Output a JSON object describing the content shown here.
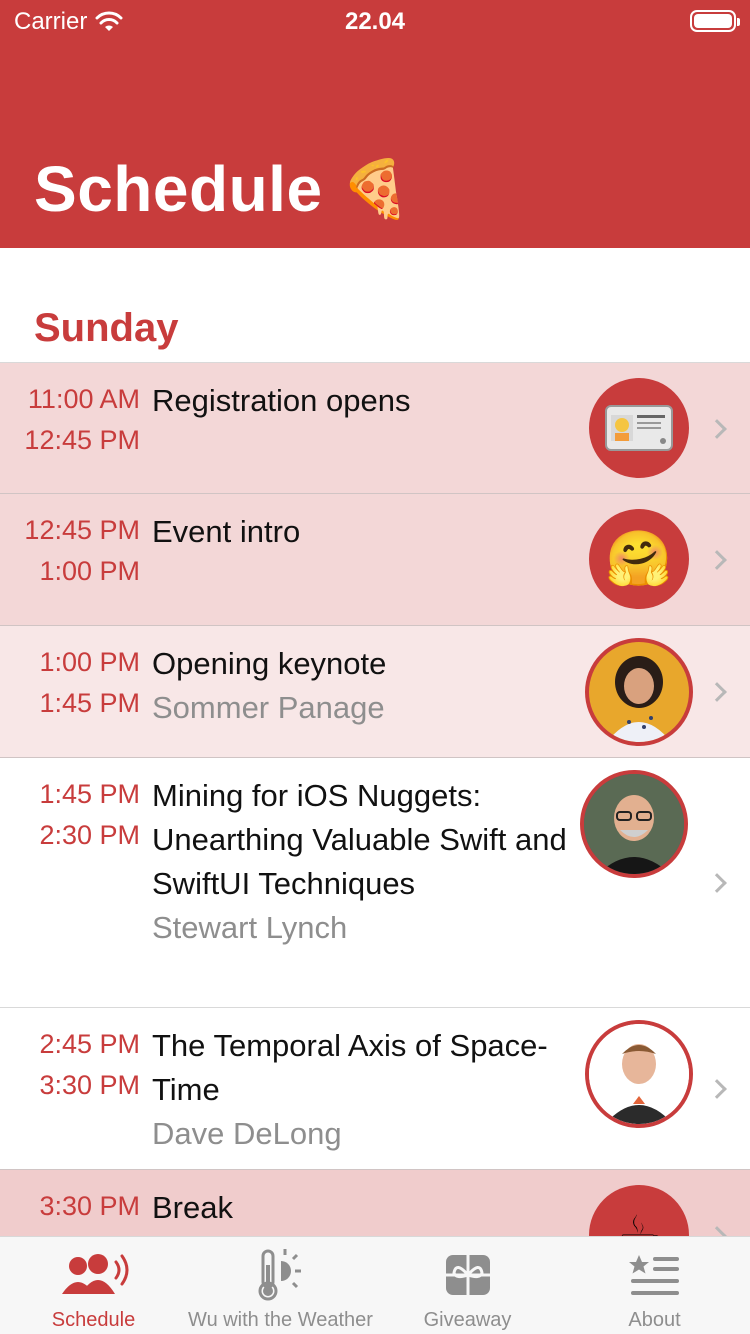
{
  "status": {
    "carrier": "Carrier",
    "time": "22.04"
  },
  "header": {
    "title": "Schedule",
    "emoji": "🍕"
  },
  "section": {
    "title": "Sunday"
  },
  "rows": [
    {
      "start": "11:00 AM",
      "end": "12:45 PM",
      "title": "Registration opens",
      "speaker": "",
      "icon": "🪪"
    },
    {
      "start": "12:45 PM",
      "end": "1:00 PM",
      "title": "Event intro",
      "speaker": "",
      "icon": "🤗"
    },
    {
      "start": "1:00 PM",
      "end": "1:45 PM",
      "title": "Opening keynote",
      "speaker": "Sommer Panage",
      "icon": ""
    },
    {
      "start": "1:45 PM",
      "end": "2:30 PM",
      "title": "Mining for iOS Nuggets: Unearthing Valuable Swift and SwiftUI Techniques",
      "speaker": "Stewart Lynch",
      "icon": ""
    },
    {
      "start": "2:45 PM",
      "end": "3:30 PM",
      "title": "The Temporal Axis of Space-Time",
      "speaker": "Dave DeLong",
      "icon": ""
    },
    {
      "start": "3:30 PM",
      "end": "",
      "title": "Break",
      "speaker": "",
      "icon": "☕"
    }
  ],
  "tabs": [
    {
      "label": "Schedule",
      "icon": "people-broadcast-icon",
      "active": true
    },
    {
      "label": "Wu with the Weather",
      "icon": "thermometer-sun-icon",
      "active": false
    },
    {
      "label": "Giveaway",
      "icon": "gift-icon",
      "active": false
    },
    {
      "label": "About",
      "icon": "list-star-icon",
      "active": false
    }
  ],
  "colors": {
    "accent": "#c83c3c",
    "row_highlight": "#f3d7d7",
    "row_light": "#f8e7e7",
    "secondary_text": "#8e8e8e"
  }
}
